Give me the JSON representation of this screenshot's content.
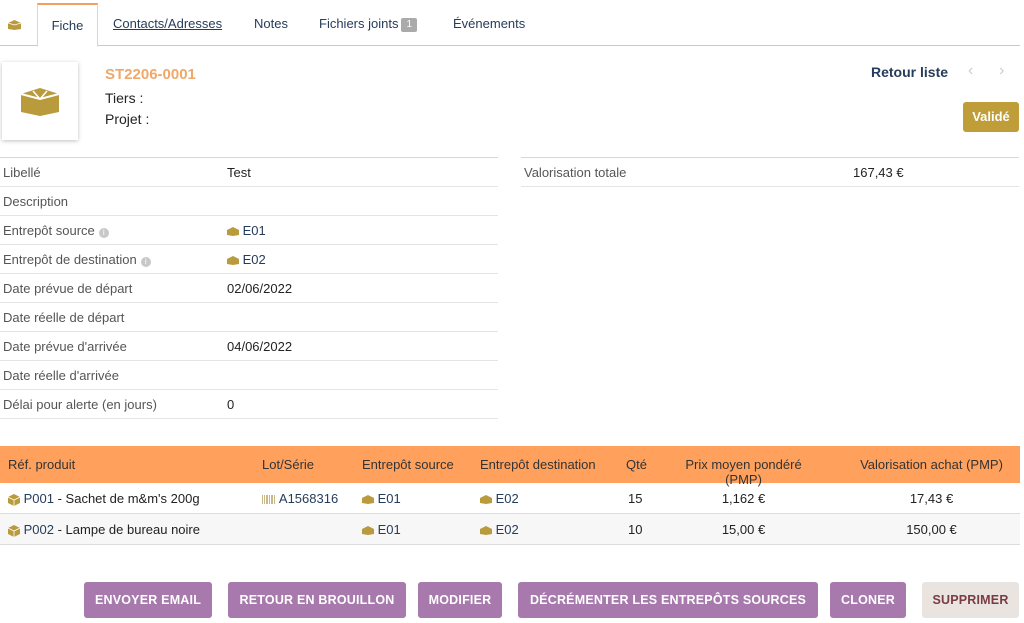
{
  "tabs": {
    "fiche": "Fiche",
    "contacts": "Contacts/Adresses",
    "notes": "Notes",
    "files": "Fichiers joints",
    "files_count": "1",
    "events": "Événements"
  },
  "banner": {
    "ref": "ST2206-0001",
    "tiers": "Tiers :",
    "projet": "Projet :",
    "retour": "Retour liste",
    "status": "Validé"
  },
  "fields": [
    {
      "label": "Libellé",
      "value": "Test"
    },
    {
      "label": "Description",
      "value": ""
    },
    {
      "label": "Entrepôt source",
      "value": "E01"
    },
    {
      "label": "Entrepôt de destination",
      "value": "E02"
    },
    {
      "label": "Date prévue de départ",
      "value": "02/06/2022"
    },
    {
      "label": "Date réelle de départ",
      "value": ""
    },
    {
      "label": "Date prévue d'arrivée",
      "value": "04/06/2022"
    },
    {
      "label": "Date réelle d'arrivée",
      "value": ""
    },
    {
      "label": "Délai pour alerte (en jours)",
      "value": "0"
    }
  ],
  "right_fields": [
    {
      "label": "Valorisation totale",
      "value": "167,43 €"
    }
  ],
  "lines": {
    "headers": [
      "Réf. produit",
      "Lot/Série",
      "Entrepôt source",
      "Entrepôt destination",
      "Qté",
      "Prix moyen pondéré (PMP)",
      "Valorisation achat (PMP)"
    ],
    "rows": [
      {
        "ref": "P001",
        "label": " - Sachet de m&m's 200g",
        "lot": "A1568316",
        "src": "E01",
        "dst": "E02",
        "qty": "15",
        "pmp": "1,162 €",
        "val": "17,43 €"
      },
      {
        "ref": "P002",
        "label": " - Lampe de bureau noire",
        "lot": "",
        "src": "E01",
        "dst": "E02",
        "qty": "10",
        "pmp": "15,00 €",
        "val": "150,00 €"
      }
    ]
  },
  "buttons": {
    "email": "ENVOYER EMAIL",
    "draft": "RETOUR EN BROUILLON",
    "modify": "MODIFIER",
    "decrement": "DÉCRÉMENTER LES ENTREPÔTS SOURCES",
    "clone": "CLONER",
    "delete": "SUPPRIMER"
  },
  "colors": {
    "accent": "#ffa15c",
    "status": "#bf9d39",
    "button": "#a779ad",
    "ref": "#f0a868",
    "link": "#263c5c"
  },
  "icons": {
    "module": "box-icon",
    "product": "cube-icon",
    "warehouse": "warehouse-icon",
    "lot": "barcode-icon",
    "info": "info-icon"
  }
}
